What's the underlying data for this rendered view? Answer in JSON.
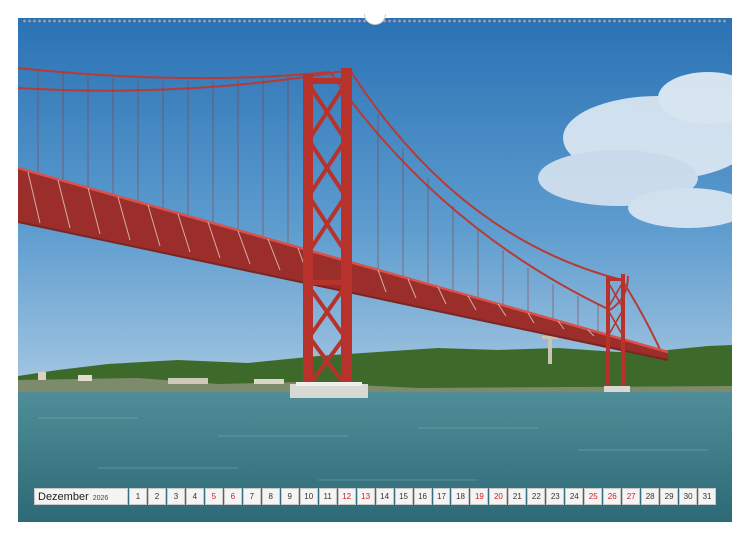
{
  "calendar": {
    "month": "Dezember",
    "year": "2026",
    "days": [
      {
        "num": "1",
        "holiday": false
      },
      {
        "num": "2",
        "holiday": false
      },
      {
        "num": "3",
        "holiday": false
      },
      {
        "num": "4",
        "holiday": false
      },
      {
        "num": "5",
        "holiday": true
      },
      {
        "num": "6",
        "holiday": true
      },
      {
        "num": "7",
        "holiday": false
      },
      {
        "num": "8",
        "holiday": false
      },
      {
        "num": "9",
        "holiday": false
      },
      {
        "num": "10",
        "holiday": false
      },
      {
        "num": "11",
        "holiday": false
      },
      {
        "num": "12",
        "holiday": true
      },
      {
        "num": "13",
        "holiday": true
      },
      {
        "num": "14",
        "holiday": false
      },
      {
        "num": "15",
        "holiday": false
      },
      {
        "num": "16",
        "holiday": false
      },
      {
        "num": "17",
        "holiday": false
      },
      {
        "num": "18",
        "holiday": false
      },
      {
        "num": "19",
        "holiday": true
      },
      {
        "num": "20",
        "holiday": true
      },
      {
        "num": "21",
        "holiday": false
      },
      {
        "num": "22",
        "holiday": false
      },
      {
        "num": "23",
        "holiday": false
      },
      {
        "num": "24",
        "holiday": false
      },
      {
        "num": "25",
        "holiday": true
      },
      {
        "num": "26",
        "holiday": true
      },
      {
        "num": "27",
        "holiday": true
      },
      {
        "num": "28",
        "holiday": false
      },
      {
        "num": "29",
        "holiday": false
      },
      {
        "num": "30",
        "holiday": false
      },
      {
        "num": "31",
        "holiday": false
      }
    ]
  },
  "colors": {
    "sky_top": "#2e78b8",
    "sky_bottom": "#86b4d8",
    "bridge_red": "#b8322c",
    "water": "#3e7f8c",
    "hills": "#3f6b2c",
    "holiday_text": "#d21e1e"
  }
}
